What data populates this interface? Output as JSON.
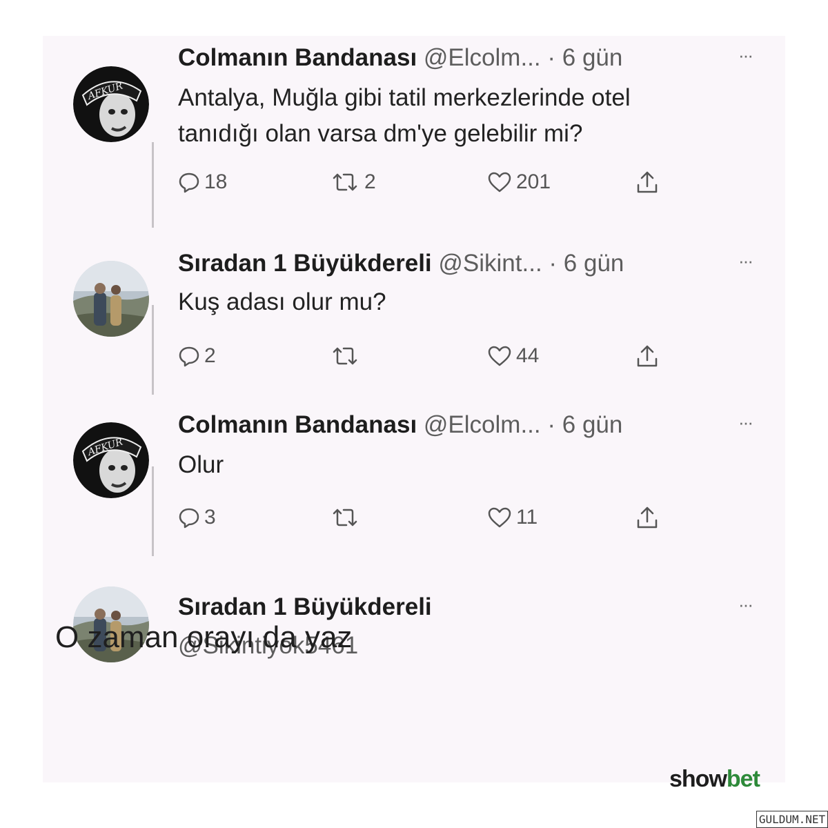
{
  "tweets": [
    {
      "name": "Colmanın Bandanası",
      "handle": "@Elcolm...",
      "time": "· 6 gün",
      "more": "···",
      "text_lines": [
        "Antalya, Muğla gibi tatil merkezlerinde otel",
        "tanıdığı olan varsa dm'ye gelebilir mi?"
      ],
      "avatar_label": "AFKUR",
      "replies": "18",
      "retweets": "2",
      "likes": "201"
    },
    {
      "name": "Sıradan 1 Büyükdereli",
      "handle": "@Sikint...",
      "time": "· 6 gün",
      "more": "···",
      "text_lines": [
        "Kuş adası olur mu?"
      ],
      "replies": "2",
      "retweets": "",
      "likes": "44"
    },
    {
      "name": "Colmanın Bandanası",
      "handle": "@Elcolm...",
      "time": "· 6 gün",
      "more": "···",
      "text_lines": [
        "Olur"
      ],
      "avatar_label": "AFKUR",
      "replies": "3",
      "retweets": "",
      "likes": "11"
    },
    {
      "name": "Sıradan 1 Büyükdereli",
      "handle": "@Sikintiyok5461",
      "more": "···"
    }
  ],
  "reply_text": "O zaman orayı da yaz",
  "branding": {
    "part1": "show",
    "part2": "bet",
    "watermark": "GULDUM.NET"
  },
  "colors": {
    "card_bg": "#faf6fa",
    "thread_line": "#c7c3c7",
    "brand_green": "#2e8a3a"
  }
}
